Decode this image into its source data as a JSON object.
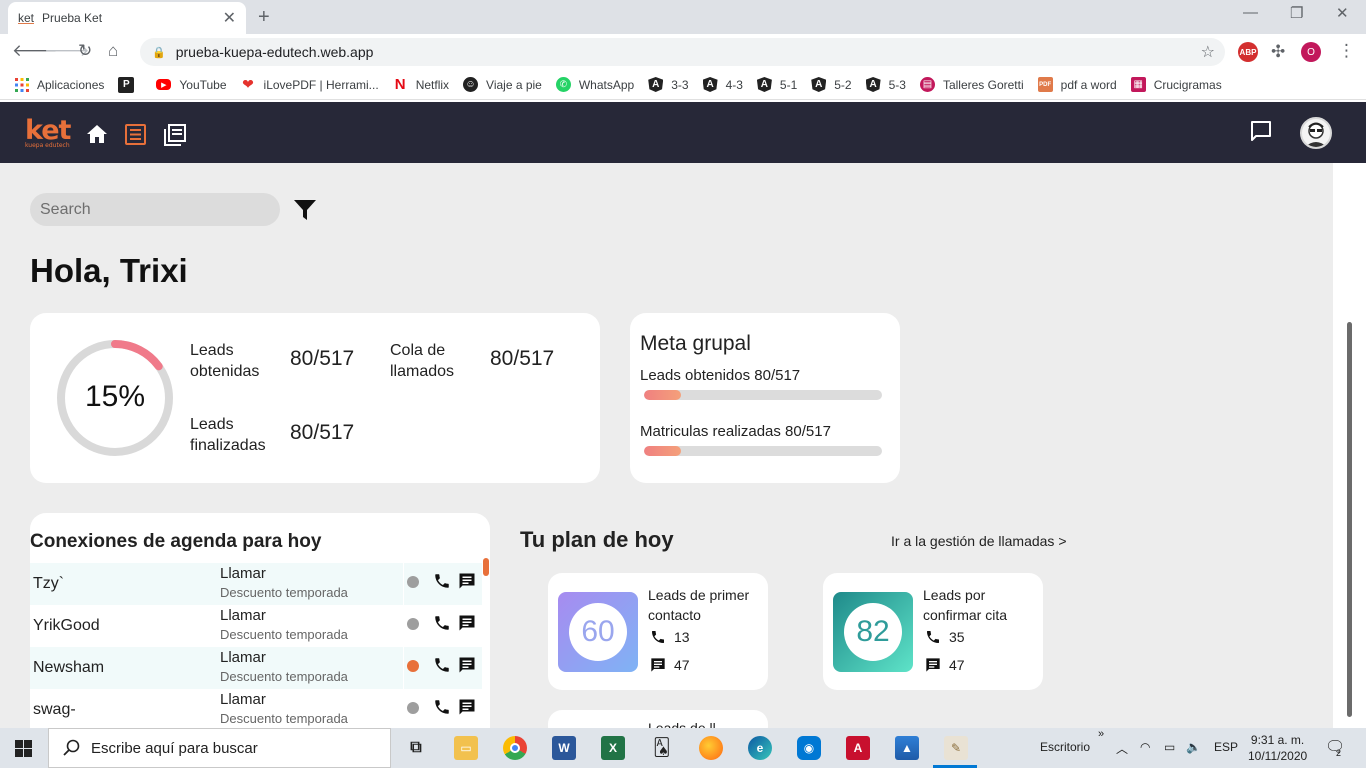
{
  "browser": {
    "tab_title": "Prueba Ket",
    "tab_favicon_text": "ket",
    "url": "prueba-kuepa-edutech.web.app",
    "bookmarks": [
      {
        "label": "Aplicaciones",
        "icon": "apps-grid-icon"
      },
      {
        "label": "",
        "icon": "p-icon"
      },
      {
        "label": "YouTube",
        "icon": "youtube-icon"
      },
      {
        "label": "iLovePDF | Herrami...",
        "icon": "ilovepdf-icon"
      },
      {
        "label": "Netflix",
        "icon": "netflix-icon"
      },
      {
        "label": "Viaje a pie",
        "icon": "traveler-icon"
      },
      {
        "label": "WhatsApp",
        "icon": "whatsapp-icon"
      },
      {
        "label": "3-3",
        "icon": "angular-icon"
      },
      {
        "label": "4-3",
        "icon": "angular-icon"
      },
      {
        "label": "5-1",
        "icon": "angular-icon"
      },
      {
        "label": "5-2",
        "icon": "angular-icon"
      },
      {
        "label": "5-3",
        "icon": "angular-icon"
      },
      {
        "label": "Talleres Goretti",
        "icon": "talleres-icon"
      },
      {
        "label": "pdf a word",
        "icon": "pdf-doc-icon"
      },
      {
        "label": "Crucigramas",
        "icon": "crossword-icon"
      }
    ],
    "profile_initial": "O",
    "adblock_label": "ABP"
  },
  "app": {
    "logo_text": "ket",
    "logo_sub": "kuepa edutech",
    "search_placeholder": "Search",
    "greeting": "Hola, Trixi",
    "summary": {
      "progress_percent": 15,
      "progress_label": "15%",
      "leads_obtenidas_label": "Leads obtenidas",
      "leads_obtenidas_value": "80/517",
      "cola_label": "Cola de llamados",
      "cola_value": "80/517",
      "leads_finalizadas_label": "Leads finalizadas",
      "leads_finalizadas_value": "80/517"
    },
    "meta": {
      "title": "Meta grupal",
      "bars": [
        {
          "label": "Leads obtenidos 80/517",
          "fraction": 0.155
        },
        {
          "label": "Matriculas realizadas 80/517",
          "fraction": 0.155
        }
      ]
    },
    "agenda": {
      "title": "Conexiones de agenda para hoy",
      "rows": [
        {
          "name": "Tzy`",
          "action": "Llamar",
          "desc": "Descuento temporada",
          "status_color": "#9e9e9e"
        },
        {
          "name": "YrikGood",
          "action": "Llamar",
          "desc": "Descuento temporada",
          "status_color": "#9e9e9e"
        },
        {
          "name": "Newsham",
          "action": "Llamar",
          "desc": "Descuento temporada",
          "status_color": "#e8703a"
        },
        {
          "name": "swag-",
          "action": "Llamar",
          "desc": "Descuento temporada",
          "status_color": "#9e9e9e"
        }
      ]
    },
    "plan": {
      "title": "Tu plan de hoy",
      "link": "Ir a la gestión de llamadas >",
      "cards": [
        {
          "number": "60",
          "label": "Leads de primer contacto",
          "calls": "13",
          "messages": "47",
          "color_from": "#a78bf0",
          "color_to": "#7fb3f5",
          "number_color": "#9aa6ee"
        },
        {
          "number": "82",
          "label": "Leads por confirmar cita",
          "calls": "35",
          "messages": "47",
          "color_from": "#1f8a8a",
          "color_to": "#5ee3c8",
          "number_color": "#2f9c9a"
        }
      ],
      "partial_card_label": "Leads de ll..."
    }
  },
  "taskbar": {
    "search_placeholder": "Escribe aquí para buscar",
    "desktop_label": "Escritorio",
    "language": "ESP",
    "time": "9:31 a. m.",
    "date": "10/11/2020",
    "notification_count": "2"
  }
}
